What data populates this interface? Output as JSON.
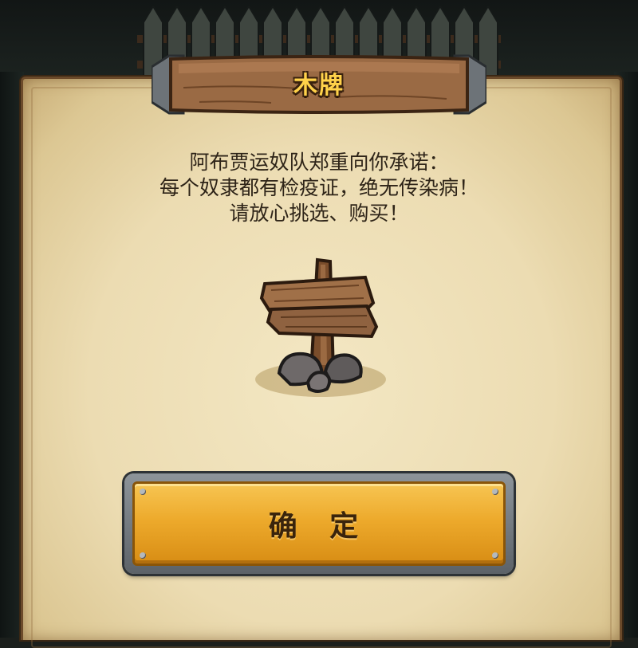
{
  "dialog": {
    "title": "木牌",
    "message_lines": [
      "阿布贾运奴队郑重向你承诺：",
      "每个奴隶都有检疫证，绝无传染病！",
      "请放心挑选、购买！"
    ],
    "item_icon": "wooden-signpost-icon",
    "confirm_label": "确 定"
  },
  "colors": {
    "title_text": "#ffd24a",
    "parchment": "#ecdcb2",
    "button_gold": "#edaa2c",
    "message_text": "#2e2418"
  }
}
